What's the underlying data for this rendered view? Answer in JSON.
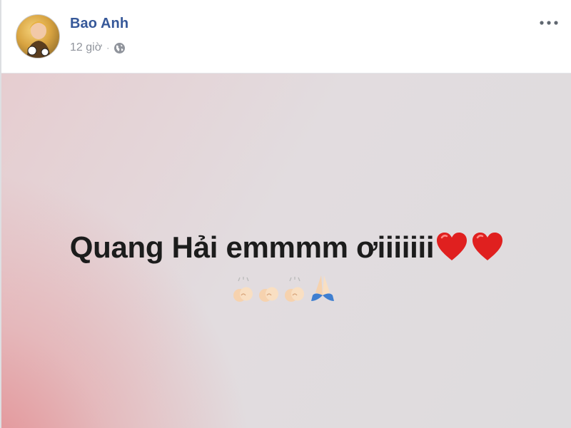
{
  "post": {
    "author": "Bao Anh",
    "time": "12 giờ",
    "privacy_icon": "globe-icon",
    "more_icon": "more-options-icon",
    "status_text": "Quang Hải emmmm ơiiiiiii",
    "status_emojis": [
      "heart",
      "heart"
    ],
    "emoji_line": [
      "clapping-hands",
      "clapping-hands",
      "clapping-hands",
      "praying-hands"
    ],
    "colors": {
      "name": "#365899",
      "meta": "#90949c",
      "heart": "#e0201f"
    }
  }
}
